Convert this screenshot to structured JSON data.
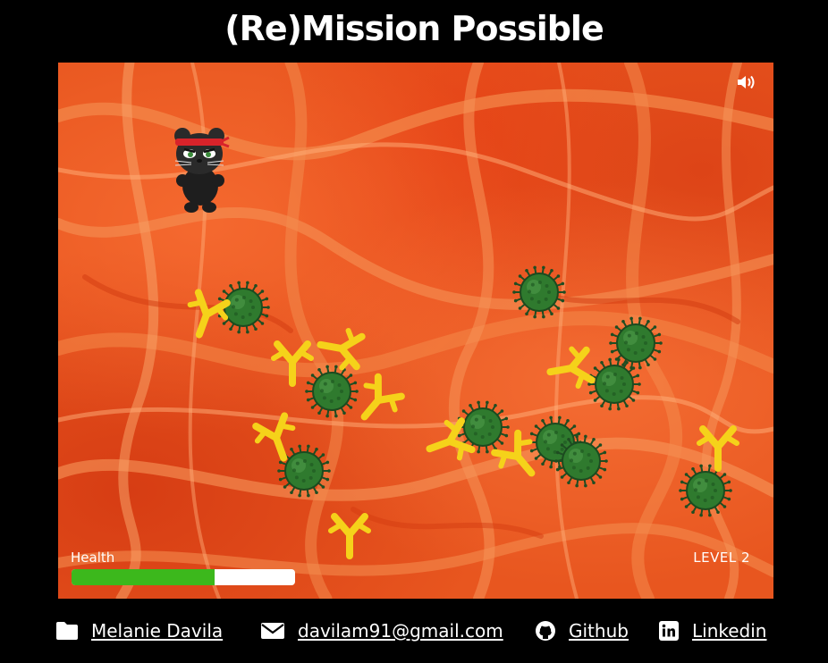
{
  "title": "(Re)Mission Possible",
  "game": {
    "sound_icon": "speaker-on-icon",
    "health_label": "Health",
    "health_fraction": 0.64,
    "level_label": "LEVEL 2",
    "colors": {
      "background": "#e8561f",
      "health_fill": "#3cb81c",
      "health_empty": "#ffffff",
      "virus": "#2f7a2e",
      "antibody": "#f5d21a"
    },
    "player": "ninja-cat-icon"
  },
  "footer": {
    "name_icon": "folder-icon",
    "name": "Melanie Davila",
    "email_icon": "envelope-icon",
    "email": "davilam91@gmail.com",
    "github_icon": "github-icon",
    "github": "Github",
    "linkedin_icon": "linkedin-icon",
    "linkedin": "Linkedin"
  }
}
